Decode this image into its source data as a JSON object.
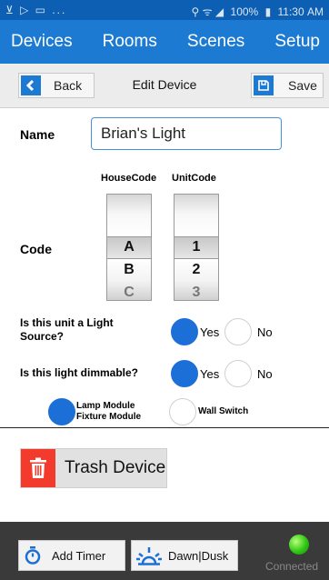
{
  "status_bar": {
    "left_icons": "⊻ ▷ ▭ ...",
    "signal_icons": "⚲ ᯤ ◢",
    "battery": "100%",
    "time": "11:30 AM"
  },
  "nav": {
    "tabs": [
      "Devices",
      "Rooms",
      "Scenes",
      "Setup"
    ]
  },
  "toolbar": {
    "back_label": "Back",
    "title": "Edit Device",
    "save_label": "Save"
  },
  "form": {
    "name_label": "Name",
    "name_value": "Brian's Light",
    "code_label": "Code",
    "housecode_label": "HouseCode",
    "unitcode_label": "UnitCode",
    "housecode_values": [
      "A",
      "B",
      "C"
    ],
    "unitcode_values": [
      "1",
      "2",
      "3"
    ],
    "housecode_selected": "A",
    "unitcode_selected": "1",
    "light_source_question": "Is this unit a Light Source?",
    "light_source_yes": "Yes",
    "light_source_no": "No",
    "light_source_selected": "Yes",
    "dimmable_question": "Is this light dimmable?",
    "dimmable_yes": "Yes",
    "dimmable_no": "No",
    "dimmable_selected": "Yes",
    "module_line1": "Lamp Module",
    "module_line2": "Fixture Module",
    "wall_switch_label": "Wall Switch",
    "module_selected": "Lamp Module"
  },
  "actions": {
    "trash_label": "Trash Device"
  },
  "bottom": {
    "add_timer_label": "Add Timer",
    "dawn_label": "Dawn|Dusk",
    "status_label": "Connected"
  },
  "colors": {
    "status_bar": "#0d5fb3",
    "nav": "#1c7ad3",
    "accent": "#1c6fd6",
    "trash": "#f23b2d",
    "connected": "#2fc714",
    "bottom_bar": "#3a3a3a"
  }
}
